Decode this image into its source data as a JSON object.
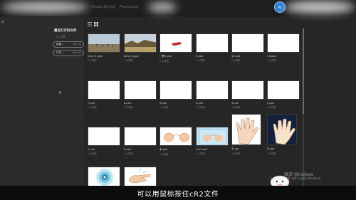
{
  "titlebar": {
    "app_name_1": "Adobe Bridge",
    "app_name_2": "Photoshop",
    "avatar_text": "Ps"
  },
  "sidebar": {
    "home_glyph": "⌂",
    "section_title": "最近打开的文件",
    "section_sub": "CC 文件",
    "new_button": {
      "label": "新建...",
      "shortcut": "Ctrl+N"
    },
    "open_button": {
      "label": "打开...",
      "shortcut": "Ctrl+O"
    }
  },
  "files": [
    {
      "name": "xing (1).jpg",
      "meta": "1 小时前",
      "type": "photo-people"
    },
    {
      "name": "long (1).jpg",
      "meta": "1 小时前",
      "type": "photo-landscape"
    },
    {
      "name": "门票1.psd",
      "meta": "1 小时前",
      "type": "ticket"
    },
    {
      "name": "9.psd",
      "meta": "1 小时前",
      "type": "blank"
    },
    {
      "name": "10.psd",
      "meta": "1 小时前",
      "type": "blank"
    },
    {
      "name": "11.psd",
      "meta": "1 小时前",
      "type": "blank"
    },
    {
      "name": "7.psd",
      "meta": "1 小时前",
      "type": "blank"
    },
    {
      "name": "8.psd",
      "meta": "1 小时前",
      "type": "blank"
    },
    {
      "name": "5.psd",
      "meta": "1 小时前",
      "type": "blank"
    },
    {
      "name": "4.psd",
      "meta": "1 小时前",
      "type": "blank"
    },
    {
      "name": "3.psd",
      "meta": "1 小时前",
      "type": "blank"
    },
    {
      "name": "2.psd",
      "meta": "1 小时前",
      "type": "blank"
    },
    {
      "name": "1.psd",
      "meta": "1 小时前",
      "type": "blank"
    },
    {
      "name": "6.psd",
      "meta": "1 小时前",
      "type": "blank"
    },
    {
      "name": "手.psd",
      "meta": "1 小时前",
      "type": "hands"
    },
    {
      "name": "cc23.psd",
      "meta": "1 小时前",
      "type": "hands-blue"
    },
    {
      "name": "手.jpg",
      "meta": "1 小时前",
      "type": "hand-sketch"
    },
    {
      "name": "手.jpg",
      "meta": "1 小时前",
      "type": "hand-dark"
    },
    {
      "name": "",
      "meta": "",
      "type": "cd"
    },
    {
      "name": "",
      "meta": "",
      "type": "hand-point"
    }
  ],
  "watermark": {
    "line1": "激活 Windows",
    "line2": "转到\"设置\"以激活 Windows。"
  },
  "subtitle": "可以用鼠标按住cR2文件",
  "colors": {
    "background": "#262626",
    "panel": "#2b2b2b",
    "thumbnail": "#ffffff",
    "accent_blue": "#2c7fd6",
    "caption_bar": "#0c0c0c"
  }
}
